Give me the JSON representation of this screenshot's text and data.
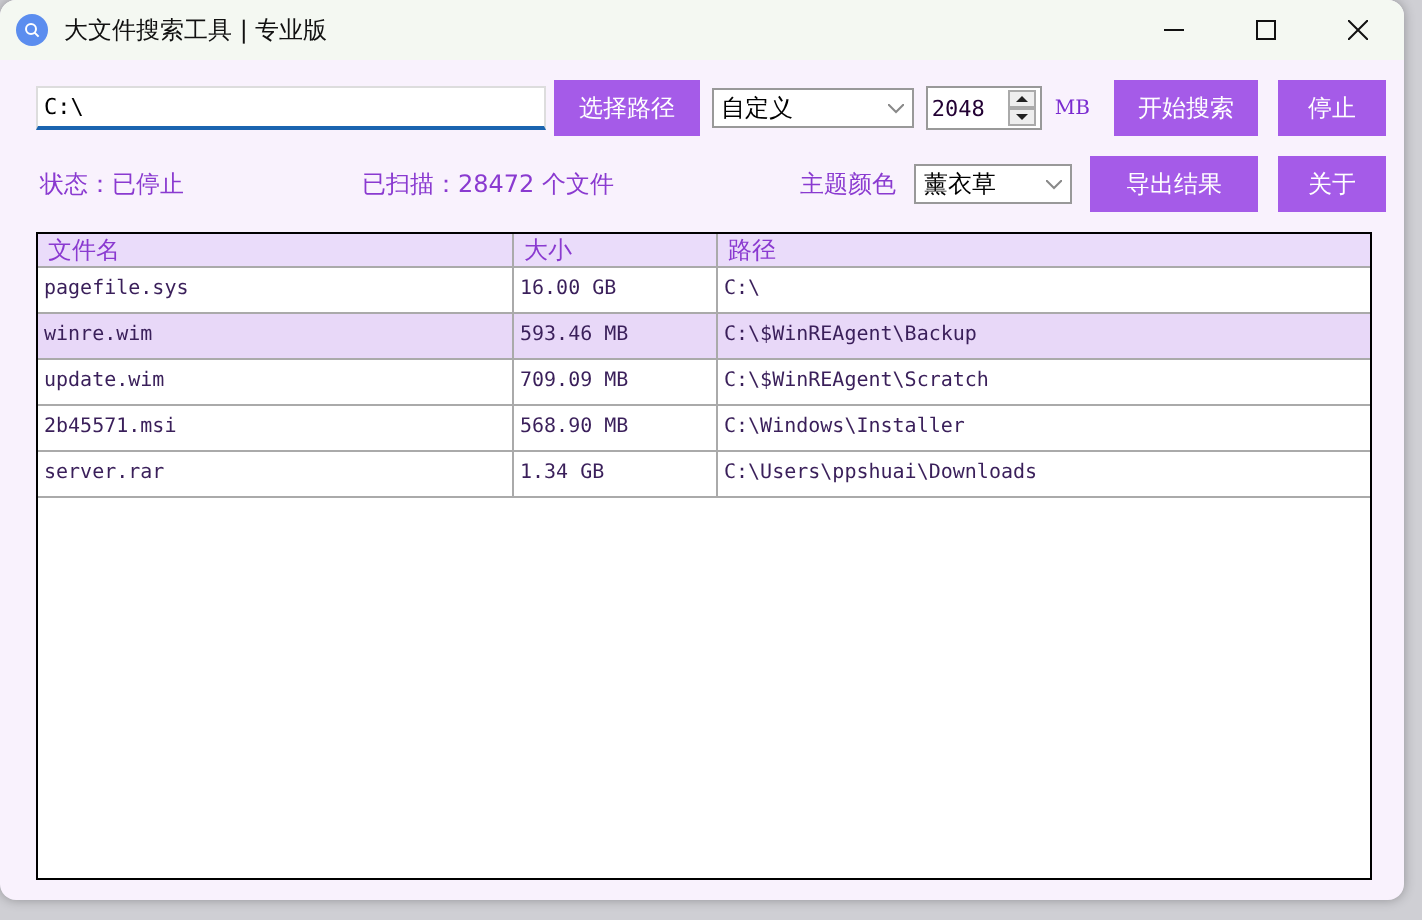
{
  "window": {
    "title": "大文件搜索工具 | 专业版"
  },
  "path_field": {
    "value": "C:\\"
  },
  "choose_path_button": "选择路径",
  "preset_select": {
    "value": "自定义"
  },
  "size_spinner": {
    "value": "2048"
  },
  "size_unit": "MB",
  "start_button": "开始搜索",
  "stop_button": "停止",
  "status": "状态：已停止",
  "scanned": "已扫描：28472 个文件",
  "theme_label": "主题颜色",
  "theme_select": {
    "value": "薰衣草"
  },
  "export_button": "导出结果",
  "about_button": "关于",
  "table": {
    "columns": [
      "文件名",
      "大小",
      "路径"
    ],
    "rows": [
      {
        "cells": [
          "pagefile.sys",
          "16.00 GB",
          "C:\\"
        ],
        "selected": false
      },
      {
        "cells": [
          "winre.wim",
          "593.46 MB",
          "C:\\$WinREAgent\\Backup"
        ],
        "selected": true
      },
      {
        "cells": [
          "update.wim",
          "709.09 MB",
          "C:\\$WinREAgent\\Scratch"
        ],
        "selected": false
      },
      {
        "cells": [
          "2b45571.msi",
          "568.90 MB",
          "C:\\Windows\\Installer"
        ],
        "selected": false
      },
      {
        "cells": [
          "server.rar",
          "1.34 GB",
          "C:\\Users\\ppshuai\\Downloads"
        ],
        "selected": false
      }
    ]
  }
}
